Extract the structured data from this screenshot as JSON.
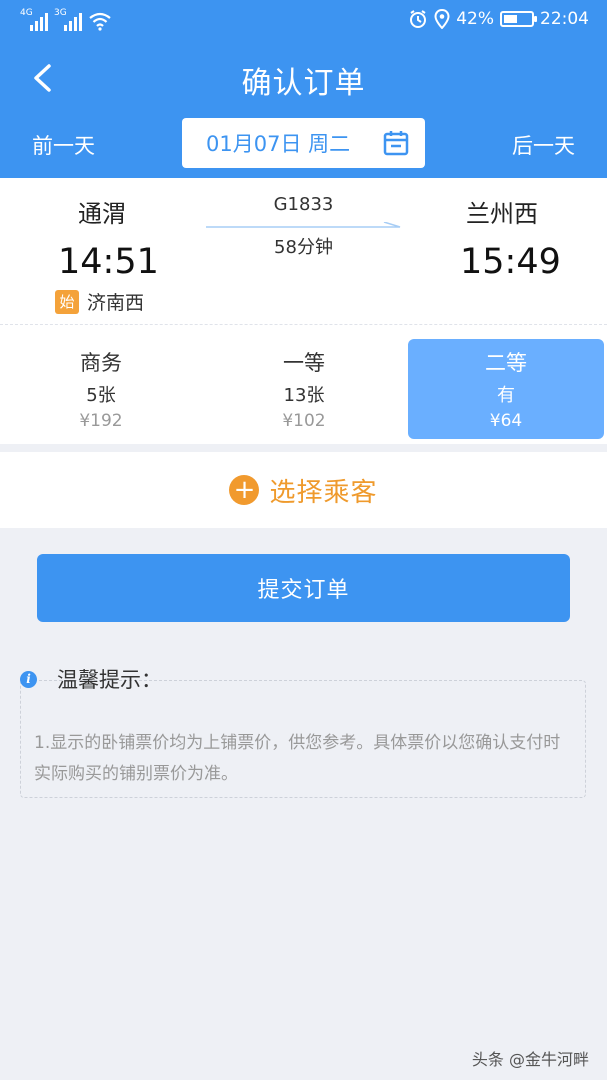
{
  "status_bar": {
    "net1": "4G",
    "net2": "3G",
    "battery": "42%",
    "time": "22:04"
  },
  "header": {
    "title": "确认订单",
    "prev_day": "前一天",
    "next_day": "后一天",
    "date": "01月07日 周二"
  },
  "train": {
    "from_station": "通渭",
    "to_station": "兰州西",
    "train_no": "G1833",
    "duration": "58分钟",
    "dep_time": "14:51",
    "arr_time": "15:49",
    "origin_badge": "始",
    "origin_station": "济南西"
  },
  "seats": [
    {
      "name": "商务",
      "count": "5张",
      "price": "¥192"
    },
    {
      "name": "一等",
      "count": "13张",
      "price": "¥102"
    },
    {
      "name": "二等",
      "count": "有",
      "price": "¥64"
    }
  ],
  "passenger": {
    "plus": "+",
    "label": "选择乘客"
  },
  "submit_label": "提交订单",
  "tips": {
    "icon": "i",
    "title": "温馨提示：",
    "text": "1.显示的卧铺票价均为上铺票价，供您参考。具体票价以您确认支付时实际购买的铺别票价为准。"
  },
  "watermark": "头条 @金牛河畔",
  "colors": {
    "primary": "#3d94f1",
    "selected_seat": "#6aafff",
    "accent_orange": "#ef9a2c"
  }
}
